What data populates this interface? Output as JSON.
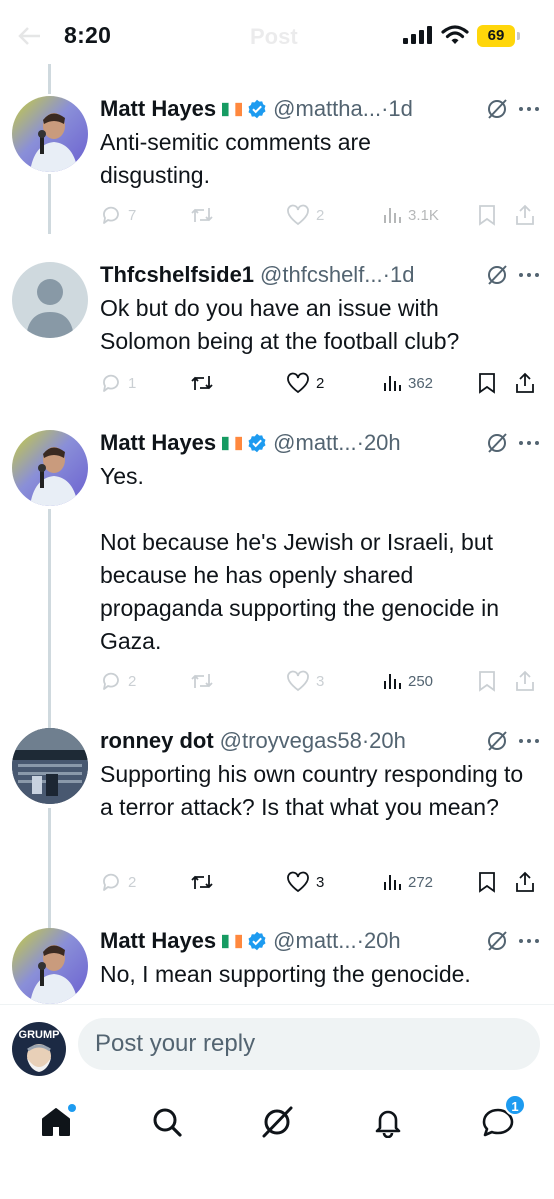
{
  "status_bar": {
    "time": "8:20",
    "battery": "69",
    "ghost_title": "Post"
  },
  "tweets": [
    {
      "author": "Matt Hayes",
      "handle": "@mattha...",
      "time": "·1d",
      "text": "Anti-semitic comments are disgusting.",
      "flag": "ireland-flag-emoji",
      "verified": true,
      "replies": "7",
      "retweets": "",
      "likes": "2",
      "views": "3.1K"
    },
    {
      "author": "Thfcshelfside1",
      "handle": "@thfcshelf...",
      "time": "·1d",
      "text": "Ok but do you have an issue with Solomon being at the football club?",
      "verified": false,
      "replies": "1",
      "retweets": "",
      "likes": "2",
      "views": "362"
    },
    {
      "author": "Matt Hayes",
      "handle": "@matt...",
      "time": "·20h",
      "text": "Yes.\n\nNot because he's Jewish or Israeli, but because he has openly shared propaganda supporting the genocide in Gaza.",
      "flag": "ireland-flag-emoji",
      "verified": true,
      "replies": "2",
      "retweets": "",
      "likes": "3",
      "views": "250"
    },
    {
      "author": "ronney dot",
      "handle": "@troyvegas58",
      "time": "·20h",
      "text": "Supporting his own country responding to a terror attack? Is that what you mean?",
      "verified": false,
      "replies": "2",
      "retweets": "",
      "likes": "3",
      "views": "272"
    },
    {
      "author": "Matt Hayes",
      "handle": "@matt...",
      "time": "·20h",
      "text": "No, I mean supporting the genocide.",
      "flag": "ireland-flag-emoji",
      "verified": true
    }
  ],
  "reply_bar": {
    "placeholder": "Post your reply",
    "avatar_text": "GRUMP"
  },
  "nav": {
    "messages_badge": "1"
  },
  "colors": {
    "brand_blue": "#1d9bf0",
    "text_primary": "#0f1419",
    "text_secondary": "#536471",
    "battery_yellow": "#ffd60a"
  }
}
